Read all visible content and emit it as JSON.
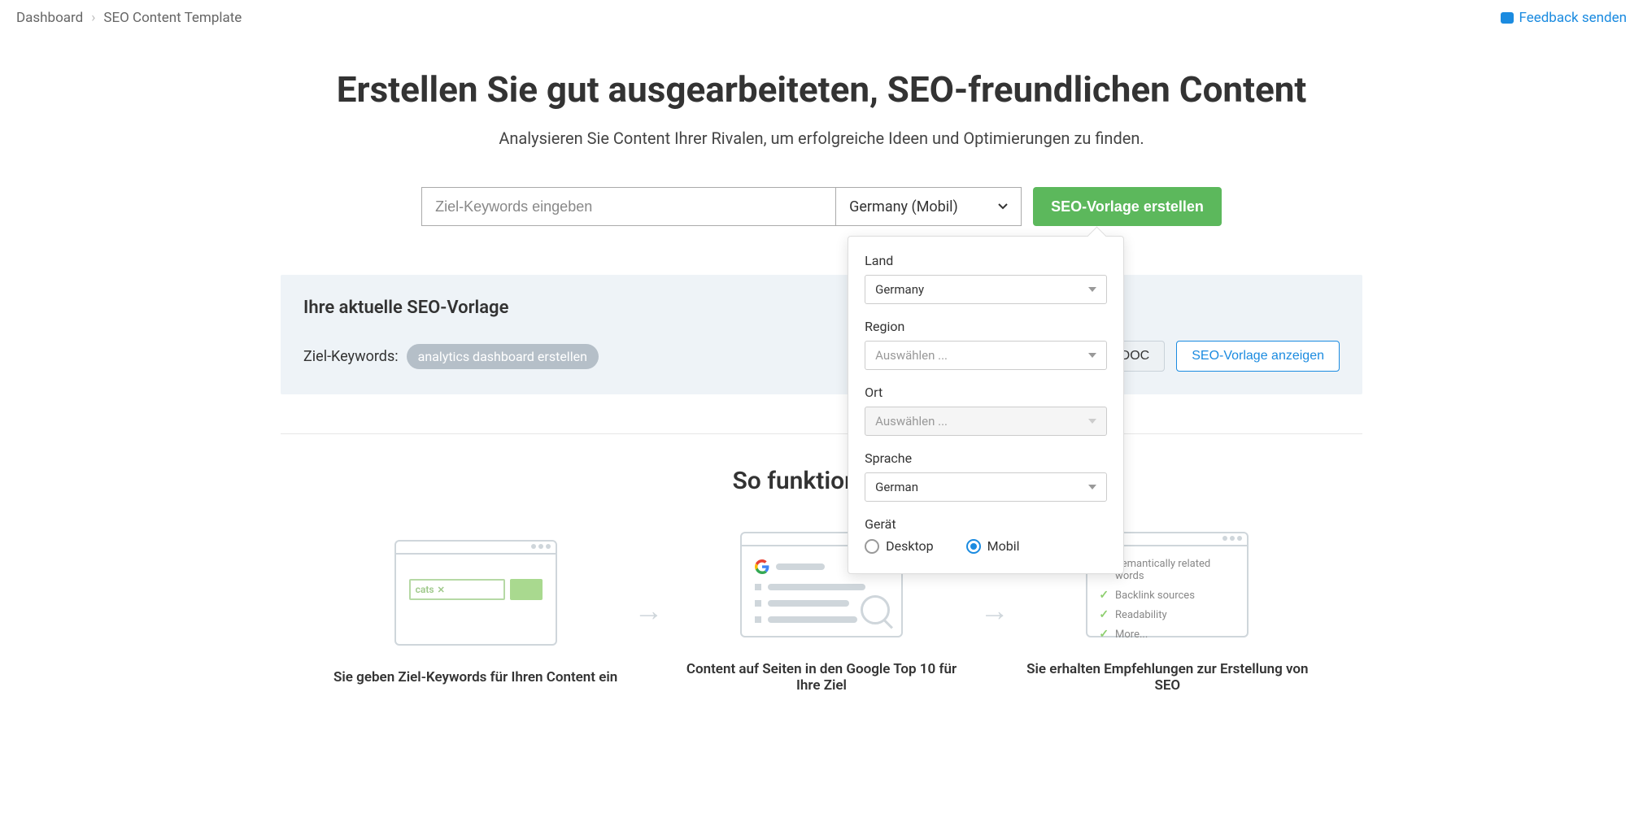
{
  "breadcrumb": {
    "dashboard": "Dashboard",
    "current": "SEO Content Template"
  },
  "feedback": "Feedback senden",
  "hero": {
    "title": "Erstellen Sie gut ausgearbeiteten, SEO-freundlichen Content",
    "subtitle": "Analysieren Sie Content Ihrer Rivalen, um erfolgreiche Ideen und Optimierungen zu finden."
  },
  "search": {
    "placeholder": "Ziel-Keywords eingeben",
    "region_label": "Germany (Mobil)",
    "button": "SEO-Vorlage erstellen"
  },
  "dropdown": {
    "country_label": "Land",
    "country_value": "Germany",
    "region_label": "Region",
    "region_value": "Auswählen ...",
    "city_label": "Ort",
    "city_value": "Auswählen ...",
    "language_label": "Sprache",
    "language_value": "German",
    "device_label": "Gerät",
    "device_desktop": "Desktop",
    "device_mobile": "Mobil"
  },
  "panel": {
    "title": "Ihre aktuelle SEO-Vorlage",
    "keywords_label": "Ziel-Keywords:",
    "chip": "analytics dashboard erstellen",
    "export_btn": "Export als DOC",
    "view_btn": "SEO-Vorlage anzeigen"
  },
  "how": {
    "title": "So funktioniert's",
    "step1_input": "cats",
    "step3_items": [
      "Semantically related words",
      "Backlink sources",
      "Readability",
      "More..."
    ],
    "step1_caption": "Sie geben Ziel-Keywords für Ihren Content ein",
    "step2_caption": "Content auf Seiten in den Google Top 10 für Ihre Ziel",
    "step3_caption": "Sie erhalten Empfehlungen zur Erstellung von SEO"
  }
}
